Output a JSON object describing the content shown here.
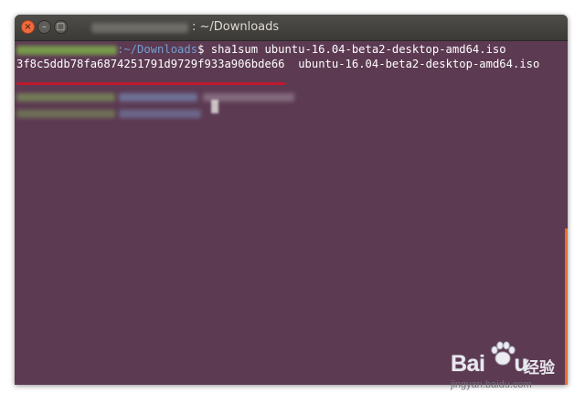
{
  "window": {
    "title_path": ": ~/Downloads",
    "buttons": {
      "close": "×",
      "minimize": "–",
      "maximize": "□"
    }
  },
  "terminal": {
    "line1": {
      "prompt_path": ":~/Downloads",
      "prompt_symbol": "$ ",
      "command": "sha1sum ubuntu-16.04-beta2-desktop-amd64.iso"
    },
    "line2": {
      "hash": "3f8c5ddb78fa6874251791d9729f933a906bde66",
      "spacer": "  ",
      "filename": "ubuntu-16.04-beta2-desktop-amd64.iso"
    }
  },
  "watermark": {
    "brand_left": "Bai",
    "brand_right": "u",
    "label": "经验",
    "url": "jingyan.baidu.com"
  },
  "colors": {
    "terminal_bg": "#5c3a52",
    "prompt_user": "#8ae234",
    "prompt_path": "#729fcf",
    "highlight_underline": "#c0192c"
  }
}
